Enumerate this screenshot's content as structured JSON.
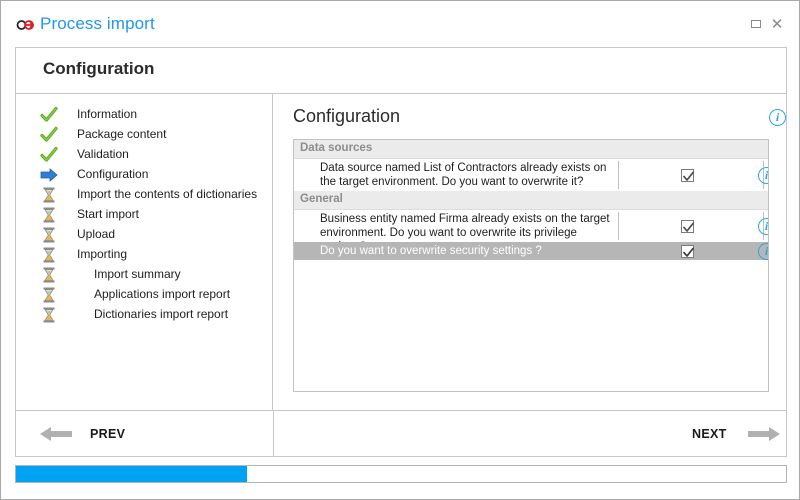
{
  "window": {
    "title": "Process import",
    "logo_icon": "chain-link-icon",
    "controls": [
      {
        "name": "restore-button",
        "icon": "restore-icon",
        "glyph": ""
      },
      {
        "name": "close-button",
        "icon": "close-icon",
        "glyph": "✕"
      }
    ]
  },
  "panel": {
    "header_title": "Configuration"
  },
  "sidebar": {
    "steps": [
      {
        "label": "Information",
        "state": "done",
        "icon": "check-icon",
        "level": 0
      },
      {
        "label": "Package content",
        "state": "done",
        "icon": "check-icon",
        "level": 0
      },
      {
        "label": "Validation",
        "state": "done",
        "icon": "check-icon",
        "level": 0
      },
      {
        "label": "Configuration",
        "state": "current",
        "icon": "arrow-right-icon",
        "level": 0
      },
      {
        "label": "Import the contents of dictionaries",
        "state": "pending",
        "icon": "hourglass-icon",
        "level": 0
      },
      {
        "label": "Start import",
        "state": "pending",
        "icon": "hourglass-icon",
        "level": 0
      },
      {
        "label": "Upload",
        "state": "pending",
        "icon": "hourglass-icon",
        "level": 0
      },
      {
        "label": "Importing",
        "state": "pending",
        "icon": "hourglass-icon",
        "level": 0
      },
      {
        "label": "Import summary",
        "state": "pending",
        "icon": "hourglass-icon",
        "level": 1
      },
      {
        "label": "Applications import report",
        "state": "pending",
        "icon": "hourglass-icon",
        "level": 1
      },
      {
        "label": "Dictionaries import report",
        "state": "pending",
        "icon": "hourglass-icon",
        "level": 1
      }
    ]
  },
  "content": {
    "title": "Configuration",
    "info_icon": "info-icon",
    "groups": [
      {
        "header": "Data sources",
        "rows": [
          {
            "text": "Data source named List of Contractors already exists on the target environment. Do you want to overwrite it?",
            "checked": true,
            "selected": false,
            "info_icon": "info-icon"
          }
        ]
      },
      {
        "header": "General",
        "rows": [
          {
            "text": "Business entity named Firma already exists on the target environment. Do you want to overwrite its privilege settings?",
            "checked": true,
            "selected": false,
            "info_icon": "info-icon"
          },
          {
            "text": "Do you want to overwrite security settings ?",
            "checked": true,
            "selected": true,
            "info_icon": "info-icon"
          }
        ]
      }
    ]
  },
  "nav": {
    "prev_label": "PREV",
    "prev_icon": "arrow-left-icon",
    "next_label": "NEXT",
    "next_icon": "arrow-right-icon"
  },
  "progress": {
    "percent": 30
  },
  "colors": {
    "accent": "#2196f3",
    "progress": "#00a2f3",
    "selection": "#b6b6b6",
    "info": "#29a8e0",
    "check": "#5caa22"
  }
}
